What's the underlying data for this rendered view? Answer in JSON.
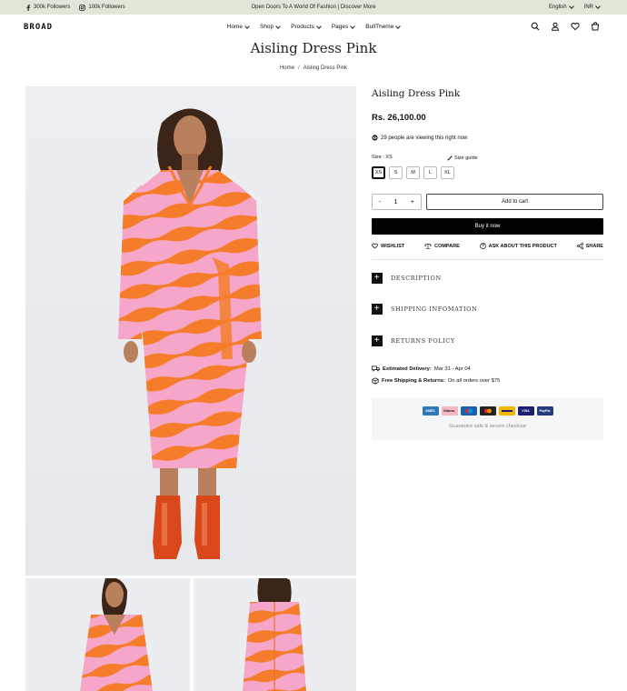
{
  "topbar": {
    "facebook_label": "300k Followers",
    "instagram_label": "100k Followers",
    "announcement": "Open Doors To A World Of Fashion | Discover More",
    "language": "English",
    "currency": "INR"
  },
  "header": {
    "logo": "BROAD",
    "nav": [
      {
        "label": "Home"
      },
      {
        "label": "Shop"
      },
      {
        "label": "Products"
      },
      {
        "label": "Pages"
      },
      {
        "label": "BullTheme"
      }
    ],
    "icons": [
      "search-icon",
      "user-icon",
      "heart-icon",
      "cart-icon"
    ]
  },
  "page": {
    "title": "Aisling Dress Pink",
    "breadcrumb": {
      "home": "Home",
      "separator": "/",
      "current": "Aisling Dress Pink"
    }
  },
  "product": {
    "title": "Aisling Dress Pink",
    "price": "Rs. 26,100.00",
    "viewers": "29 people are viewing this right now",
    "size_label": "Size : XS",
    "size_guide": "Size guide",
    "sizes": [
      "XS",
      "S",
      "M",
      "L",
      "XL"
    ],
    "selected_size": "XS",
    "quantity": "1",
    "qty_minus": "-",
    "qty_plus": "+",
    "add_to_cart": "Add to cart",
    "buy_now": "Buy it now",
    "actions": {
      "wishlist": "WISHLIST",
      "compare": "COMPARE",
      "ask": "ASK ABOUT THIS PRODUCT",
      "share": "SHARE"
    },
    "accordions": [
      "DESCRIPTION",
      "SHIPPING INFOMATION",
      "RETURNS POLICY"
    ],
    "delivery": {
      "label": "Estimated Delivery:",
      "value": "Mar 31 - Apr 04"
    },
    "shipping": {
      "label": "Free Shipping & Returns:",
      "value": "On all orders over $75"
    },
    "payment_cards": [
      {
        "name": "Amex",
        "color": "#2e77bb"
      },
      {
        "name": "Klarna",
        "color": "#f4b6c7"
      },
      {
        "name": "Maestro",
        "color": "#1a5fb4"
      },
      {
        "name": "Mastercard",
        "color": "#e8251f"
      },
      {
        "name": "Visa",
        "color": "#f7b600"
      },
      {
        "name": "VISA",
        "color": "#1a1f71"
      },
      {
        "name": "PayPal",
        "color": "#253b80"
      }
    ],
    "payment_note": "Guarantee safe & secure checkout"
  },
  "colors": {
    "topbar_bg": "#dfe8d8",
    "dress_orange": "#f47a2a",
    "dress_pink": "#f5a3c8",
    "boots": "#d9481a"
  }
}
